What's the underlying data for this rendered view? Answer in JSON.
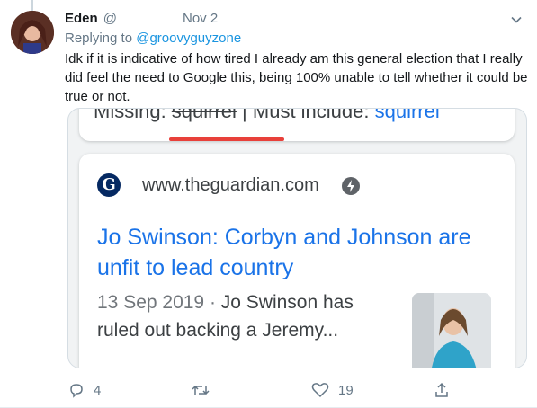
{
  "author": {
    "name": "Eden",
    "handle_visible": "@",
    "date": "Nov 2"
  },
  "reply_to": {
    "prefix": "Replying to",
    "handle": "@groovyguyzone"
  },
  "tweet_text": "Idk if it is indicative of how tired I already am this general election that I really did feel the need to Google this, being 100% unable to tell whether it could be true or not.",
  "screenshot": {
    "clipped_line_prefix": "Missing: ",
    "clipped_line_word": "squirrel",
    "clipped_line_mid": " | Must include: ",
    "clipped_line_link": "squirrel",
    "site_logo_letter": "G",
    "domain": "www.theguardian.com",
    "amp_icon": "bolt-icon",
    "result_title": "Jo Swinson: Corbyn and Johnson are unfit to lead country",
    "snippet_date": "13 Sep 2019",
    "snippet_sep": " · ",
    "snippet_text": "Jo Swinson has ruled out backing a Jeremy..."
  },
  "actions": {
    "reply_count": "4",
    "retweet_count": "",
    "like_count": "19",
    "share_count": ""
  },
  "colors": {
    "link_blue": "#1b95e0",
    "google_link": "#1a73e8",
    "muted": "#657786",
    "red_underline": "#e8403a"
  }
}
